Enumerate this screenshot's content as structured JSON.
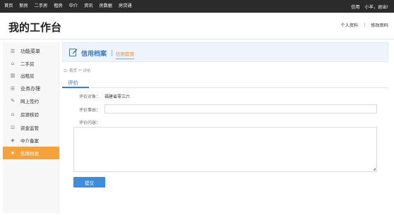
{
  "topnav": {
    "items": [
      "首页",
      "新房",
      "二手房",
      "租房",
      "中介",
      "资讯",
      "房数据",
      "房贷通"
    ]
  },
  "user": {
    "greeting": "信用",
    "name": "小羊，退出!"
  },
  "header": {
    "title": "我的工作台",
    "profile_link": "个人资料",
    "separator": "|",
    "password_link": "修改密码"
  },
  "sidebar": {
    "items": [
      {
        "label": "功能菜单",
        "icon": "menu-icon",
        "glyph": "☰"
      },
      {
        "label": "二手房",
        "icon": "house-icon",
        "glyph": "⌂"
      },
      {
        "label": "出租房",
        "icon": "building-icon",
        "glyph": "▥"
      },
      {
        "label": "业务办理",
        "icon": "list-icon",
        "glyph": "☰"
      },
      {
        "label": "网上签约",
        "icon": "edit-icon",
        "glyph": "✎"
      },
      {
        "label": "房源核验",
        "icon": "house-check-icon",
        "glyph": "⌂"
      },
      {
        "label": "资金监管",
        "icon": "lock-icon",
        "glyph": "⊡"
      },
      {
        "label": "中介备案",
        "icon": "layers-icon",
        "glyph": "◈"
      },
      {
        "label": "信用档案",
        "icon": "star-icon",
        "glyph": "★"
      }
    ],
    "active_index": 8,
    "accent_color": "#f5a23a"
  },
  "credit": {
    "title": "信用档案",
    "tab": "信用首页"
  },
  "breadcrumb": {
    "home": "首页",
    "arrow": ">",
    "current": "评价"
  },
  "section": {
    "tab": "评价"
  },
  "form": {
    "target_label": "评价对象：",
    "target_value": "福建省零三六",
    "reason_label": "评价事由：",
    "reason_value": "",
    "content_label": "评价内容：",
    "content_value": "",
    "submit_label": "提交"
  },
  "colors": {
    "topbar": "#2b2b2b",
    "accent_blue": "#3d7cc9",
    "button_blue": "#3d8ddc",
    "orange": "#f0862a"
  }
}
